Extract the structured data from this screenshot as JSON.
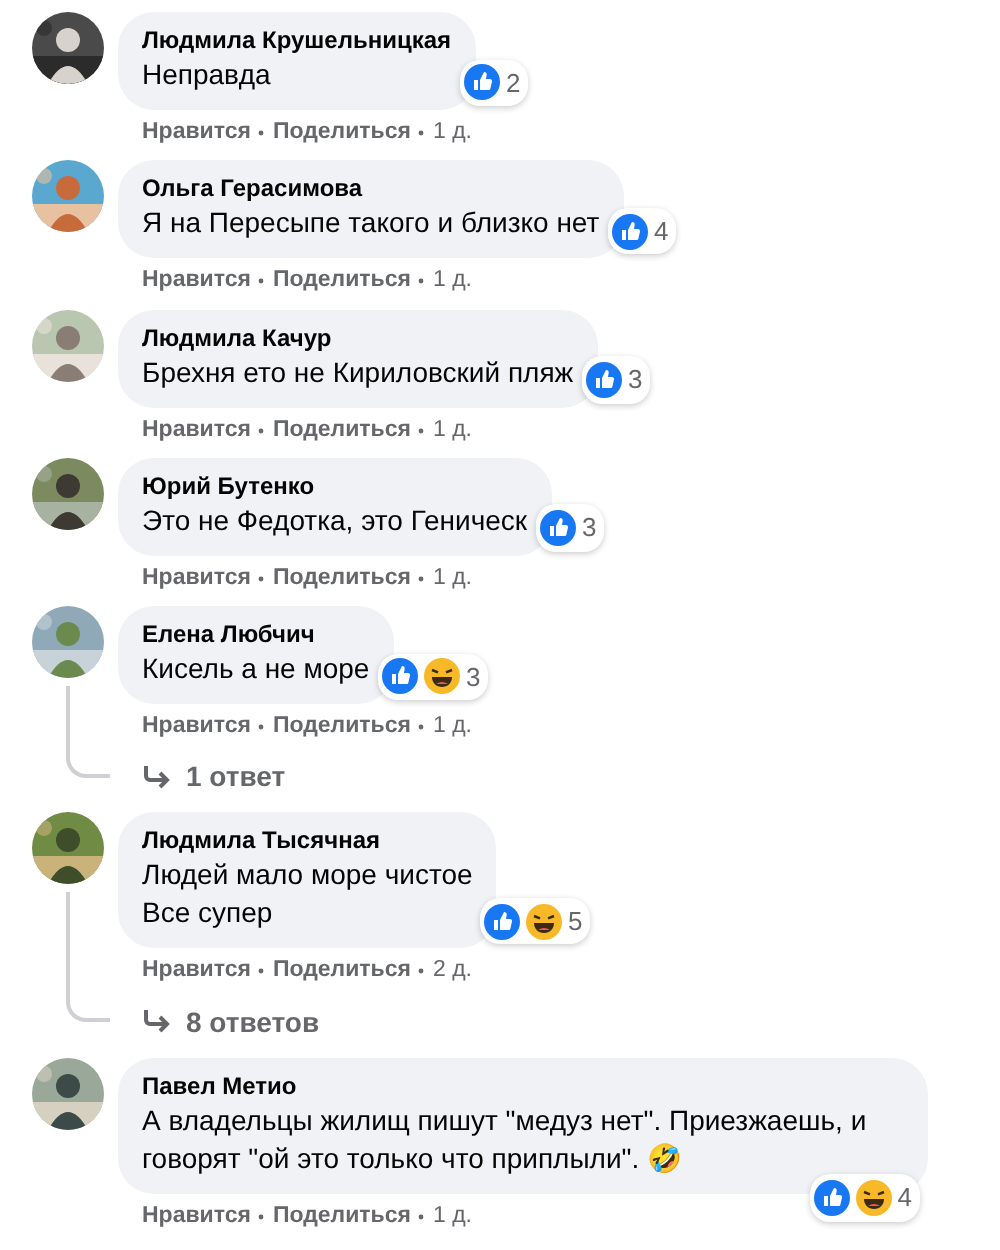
{
  "comments": [
    {
      "author": "Людмила Крушельницкая",
      "text": "Неправда",
      "reactions": [
        {
          "kind": "like"
        }
      ],
      "reaction_count": "2",
      "actions": [
        "Нравится",
        "Поделиться",
        "1 д."
      ]
    },
    {
      "author": "Ольга Герасимова",
      "text": "Я на Пересыпе такого и близко нет",
      "reactions": [
        {
          "kind": "like"
        }
      ],
      "reaction_count": "4",
      "actions": [
        "Нравится",
        "Поделиться",
        "1 д."
      ]
    },
    {
      "author": "Людмила Качур",
      "text": "Брехня ето не Кириловский пляж",
      "reactions": [
        {
          "kind": "like"
        }
      ],
      "reaction_count": "3",
      "actions": [
        "Нравится",
        "Поделиться",
        "1 д."
      ]
    },
    {
      "author": "Юрий Бутенко",
      "text": "Это не Федотка, это Геническ",
      "reactions": [
        {
          "kind": "like"
        }
      ],
      "reaction_count": "3",
      "actions": [
        "Нравится",
        "Поделиться",
        "1 д."
      ]
    },
    {
      "author": "Елена Любчич",
      "text": "Кисель а не море",
      "reactions": [
        {
          "kind": "like"
        },
        {
          "kind": "haha"
        }
      ],
      "reaction_count": "3",
      "actions": [
        "Нравится",
        "Поделиться",
        "1 д."
      ],
      "replies": "1 ответ"
    },
    {
      "author": "Людмила Тысячная",
      "text": "Людей мало море чистое\nВсе супер",
      "reactions": [
        {
          "kind": "like"
        },
        {
          "kind": "haha"
        }
      ],
      "reaction_count": "5",
      "actions": [
        "Нравится",
        "Поделиться",
        "2 д."
      ],
      "replies": "8 ответов"
    },
    {
      "author": "Павел Метио",
      "text": "А владельцы жилищ пишут \"медуз нет\". Приезжаешь, и говорят \"ой это только что приплыли\". 🤣",
      "reactions": [
        {
          "kind": "like"
        },
        {
          "kind": "haha"
        }
      ],
      "reaction_count": "4",
      "actions": [
        "Нравится",
        "Поделиться",
        "1 д."
      ]
    }
  ]
}
